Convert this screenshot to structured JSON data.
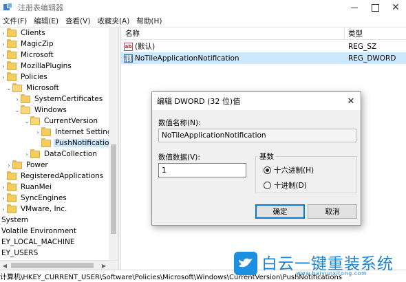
{
  "window": {
    "title": "注册表编辑器",
    "close_glyph": "✕"
  },
  "menu": [
    "文件(F)",
    "编辑(E)",
    "查看(V)",
    "收藏夹(A)",
    "帮助(H)"
  ],
  "tree": {
    "items": [
      {
        "label": "Clients",
        "expander": "›"
      },
      {
        "label": "MagicZip",
        "expander": "›"
      },
      {
        "label": "Microsoft",
        "expander": "›"
      },
      {
        "label": "MozillaPlugins",
        "expander": "›"
      },
      {
        "label": "Policies",
        "expander": "›"
      },
      {
        "label": "Microsoft",
        "expander": "⌄"
      },
      {
        "label": "SystemCertificates",
        "expander": "›"
      },
      {
        "label": "Windows",
        "expander": "⌄"
      },
      {
        "label": "CurrentVersion",
        "expander": "⌄"
      },
      {
        "label": "Internet Settings",
        "expander": "›"
      },
      {
        "label": "PushNotifications",
        "expander": ""
      },
      {
        "label": "DataCollection",
        "expander": "›"
      },
      {
        "label": "Power",
        "expander": "›"
      },
      {
        "label": "RegisteredApplications",
        "expander": ""
      },
      {
        "label": "RuanMei",
        "expander": "›"
      },
      {
        "label": "SyncEngines",
        "expander": "›"
      },
      {
        "label": "VMware, Inc.",
        "expander": "›"
      },
      {
        "label": "System",
        "expander": ""
      },
      {
        "label": "Volatile Environment",
        "expander": ""
      },
      {
        "label": "EY_LOCAL_MACHINE",
        "expander": ""
      },
      {
        "label": "EY_USERS",
        "expander": ""
      }
    ],
    "scroll_left": "◀",
    "scroll_right": "▶"
  },
  "list": {
    "headers": {
      "name": "名称",
      "type": "类型"
    },
    "rows": [
      {
        "icon": "ab",
        "name": "(默认)",
        "type": "REG_SZ"
      },
      {
        "icon": "011\n110",
        "name": "NoTileApplicationNotification",
        "type": "REG_DWORD"
      }
    ]
  },
  "statusbar": {
    "path": "计算机\\HKEY_CURRENT_USER\\Software\\Policies\\Microsoft\\Windows\\CurrentVersion\\PushNotifications"
  },
  "dialog": {
    "title": "编辑 DWORD (32 位)值",
    "close_glyph": "✕",
    "value_name_label": "数值名称(N):",
    "value_name": "NoTileApplicationNotification",
    "value_data_label": "数值数据(V):",
    "value_data": "1",
    "base_label": "基数",
    "hex_label": "十六进制(H)",
    "dec_label": "十进制(D)",
    "ok": "确定",
    "cancel": "取消"
  },
  "watermark": {
    "text": "白云一键重装系统",
    "url": "www.baiyunxitong.com"
  }
}
